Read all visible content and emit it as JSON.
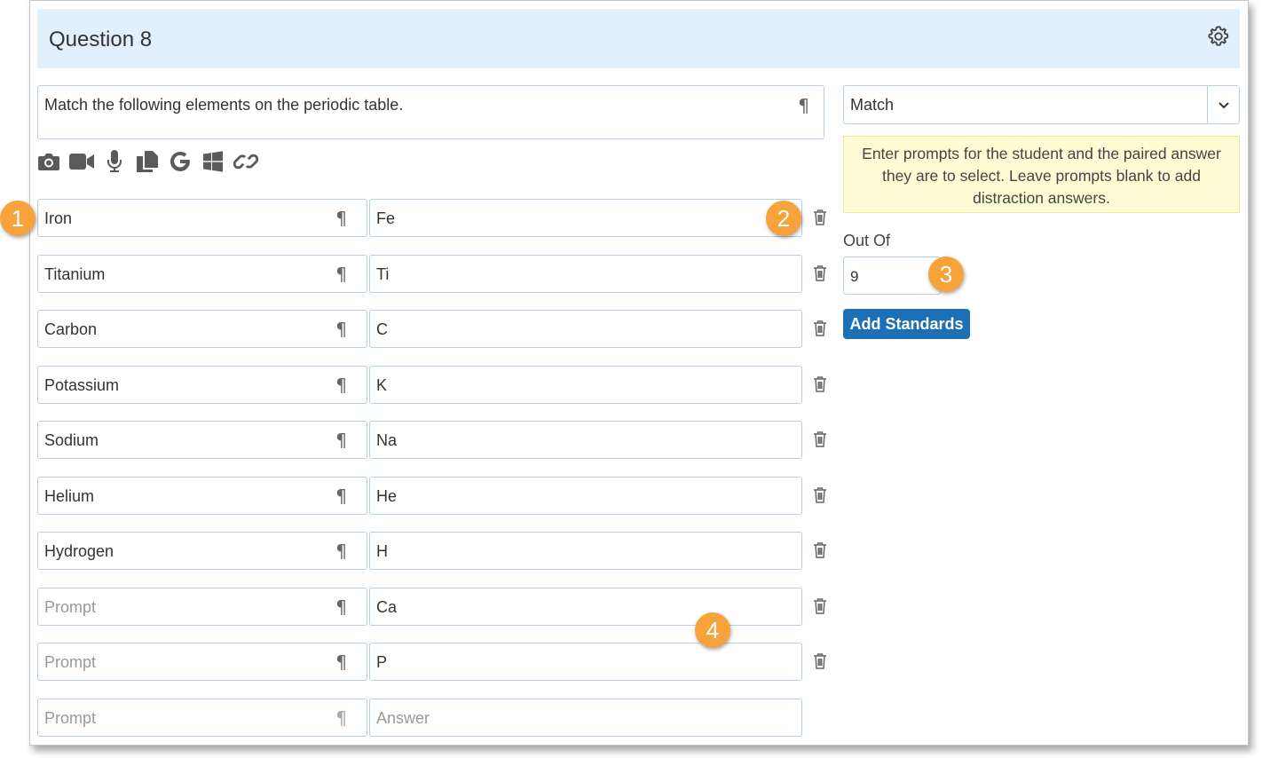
{
  "question": {
    "title": "Question 8",
    "text": "Match the following elements on the periodic table."
  },
  "paragraph_symbol": "¶",
  "media_icons": [
    "camera-icon",
    "video-icon",
    "microphone-icon",
    "copy-icon",
    "google-icon",
    "windows-icon",
    "link-icon"
  ],
  "pairs": [
    {
      "prompt": "Iron",
      "answer": "Fe"
    },
    {
      "prompt": "Titanium",
      "answer": "Ti"
    },
    {
      "prompt": "Carbon",
      "answer": "C"
    },
    {
      "prompt": "Potassium",
      "answer": "K"
    },
    {
      "prompt": "Sodium",
      "answer": "Na"
    },
    {
      "prompt": "Helium",
      "answer": "He"
    },
    {
      "prompt": "Hydrogen",
      "answer": "H"
    },
    {
      "prompt": "",
      "answer": "Ca"
    },
    {
      "prompt": "",
      "answer": "P"
    },
    {
      "prompt": "",
      "answer": ""
    }
  ],
  "placeholders": {
    "prompt": "Prompt",
    "answer": "Answer"
  },
  "question_type": "Match",
  "hint": "Enter prompts for the student and the paired answer they are to select. Leave prompts blank to add distraction answers.",
  "out_of": {
    "label": "Out Of",
    "value": "9"
  },
  "add_standards_label": "Add Standards",
  "callouts": [
    "1",
    "2",
    "3",
    "4"
  ],
  "colors": {
    "header_bg": "#e1f0fc",
    "accent": "#1e70b6",
    "hint_bg": "#fefcd4",
    "callout": "#f6a33b",
    "border": "#b7cfe0"
  }
}
